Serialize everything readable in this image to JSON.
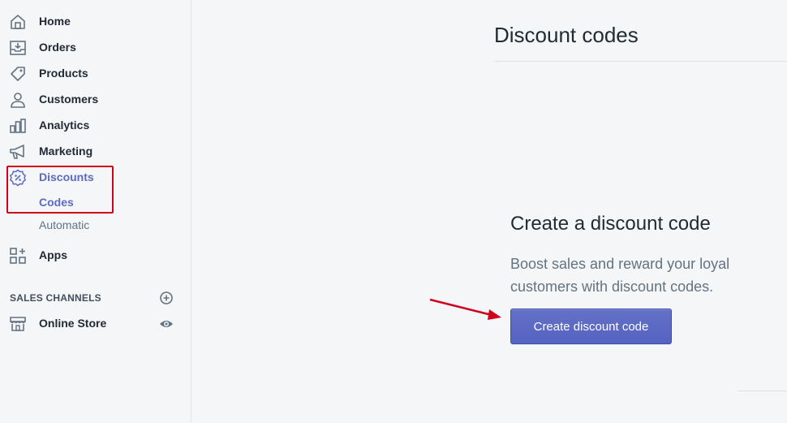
{
  "sidebar": {
    "items": [
      {
        "label": "Home",
        "icon": "home-icon"
      },
      {
        "label": "Orders",
        "icon": "orders-icon"
      },
      {
        "label": "Products",
        "icon": "tag-icon"
      },
      {
        "label": "Customers",
        "icon": "user-icon"
      },
      {
        "label": "Analytics",
        "icon": "bar-chart-icon"
      },
      {
        "label": "Marketing",
        "icon": "megaphone-icon"
      },
      {
        "label": "Discounts",
        "icon": "discount-badge-icon",
        "active": true
      },
      {
        "label": "Apps",
        "icon": "apps-grid-icon"
      }
    ],
    "discount_subitems": [
      {
        "label": "Codes",
        "active": true
      },
      {
        "label": "Automatic",
        "active": false
      }
    ],
    "sales_channels_header": "SALES CHANNELS",
    "online_store_label": "Online Store"
  },
  "main": {
    "page_title": "Discount codes",
    "empty_state": {
      "heading": "Create a discount code",
      "text": "Boost sales and reward your loyal customers with discount codes.",
      "button_label": "Create discount code"
    }
  },
  "colors": {
    "accent": "#5c6ac4",
    "button": "#5c6ac4",
    "annotation_red": "#d0021b",
    "background": "#f4f6f8"
  }
}
